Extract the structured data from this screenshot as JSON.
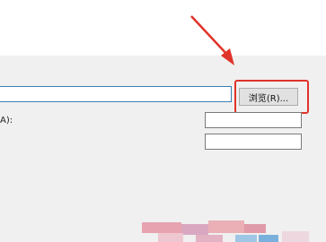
{
  "dialog": {
    "browse_label": "浏览(R)...",
    "field_label": "A):",
    "path_value": "",
    "field1_value": "",
    "field2_value": ""
  },
  "annotation": {
    "highlight_color": "#e0332a",
    "arrow_color": "#e0332a"
  }
}
